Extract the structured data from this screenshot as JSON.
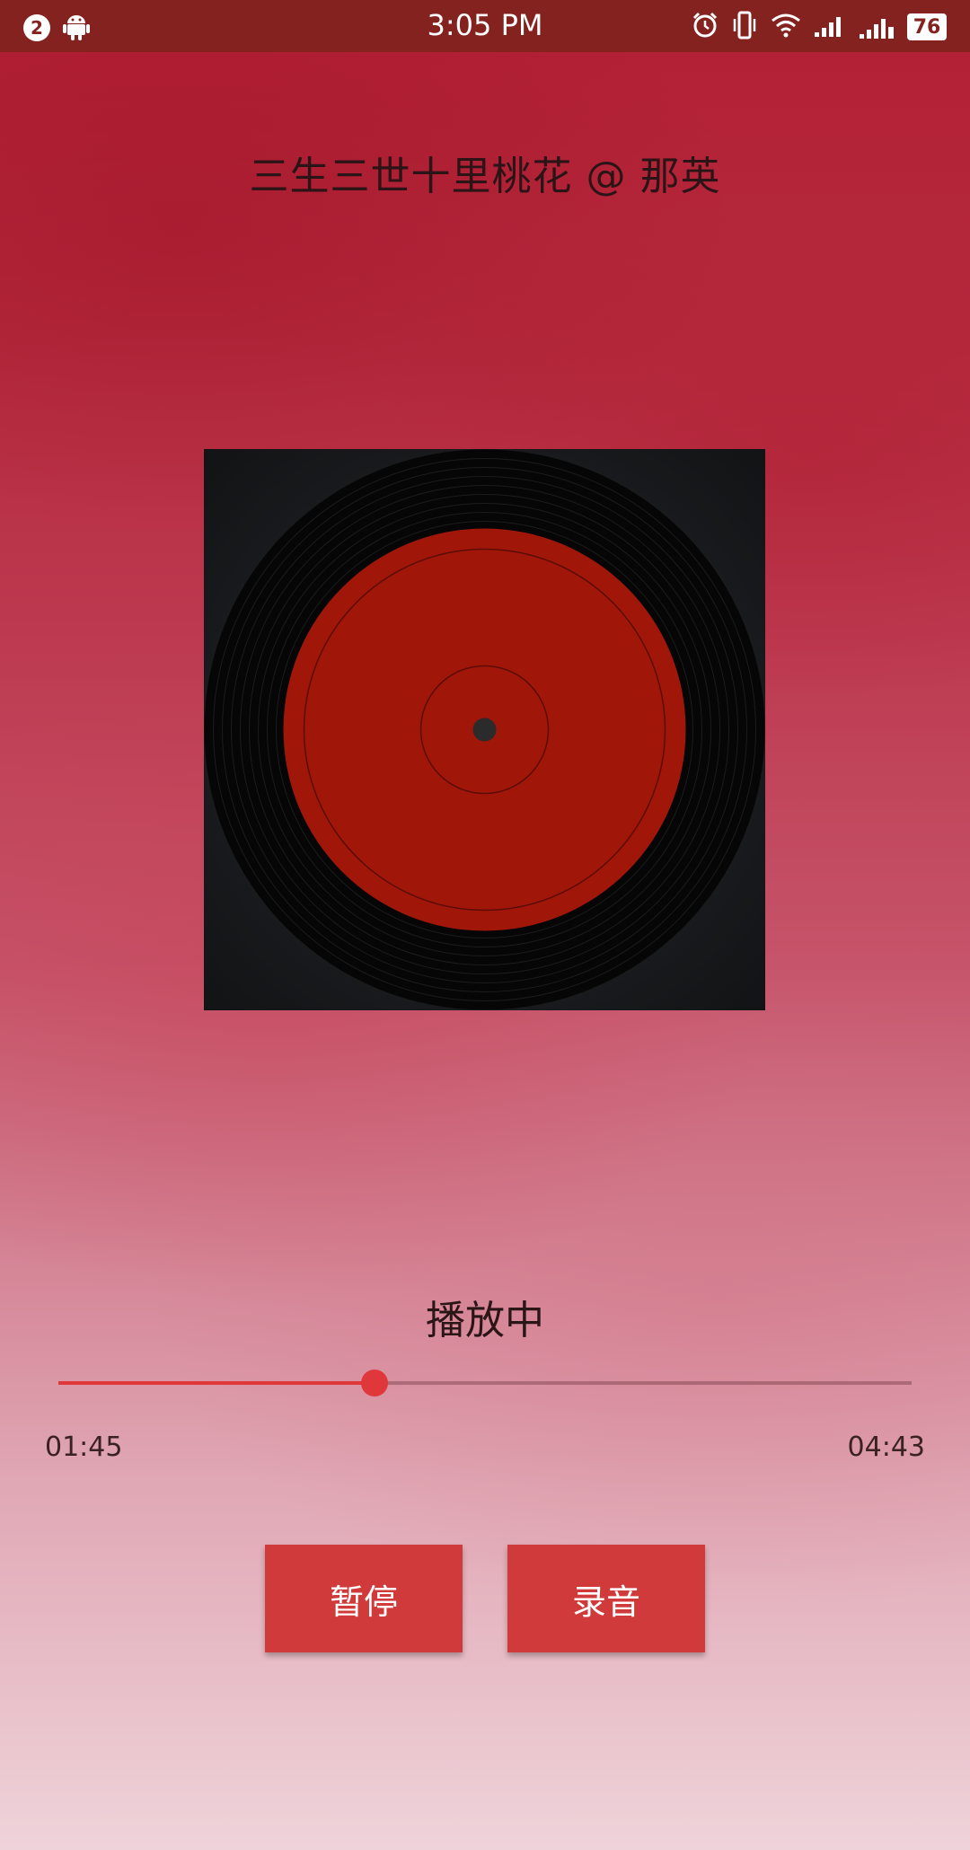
{
  "status_bar": {
    "notification_count": "2",
    "time": "3:05 PM",
    "battery": "76",
    "icons": [
      "android-icon",
      "alarm-icon",
      "vibrate-icon",
      "wifi-icon",
      "signal-icon",
      "signal-roaming-icon"
    ]
  },
  "song": {
    "title": "三生三世十里桃花 @ 那英"
  },
  "player": {
    "status_text": "播放中",
    "current_time": "01:45",
    "total_time": "04:43",
    "progress": 0.371
  },
  "buttons": {
    "pause_label": "暂停",
    "record_label": "录音"
  },
  "colors": {
    "accent": "#e0383a",
    "button": "#d03a3a",
    "status_bar": "#84221f",
    "vinyl_label": "#a0170a"
  }
}
